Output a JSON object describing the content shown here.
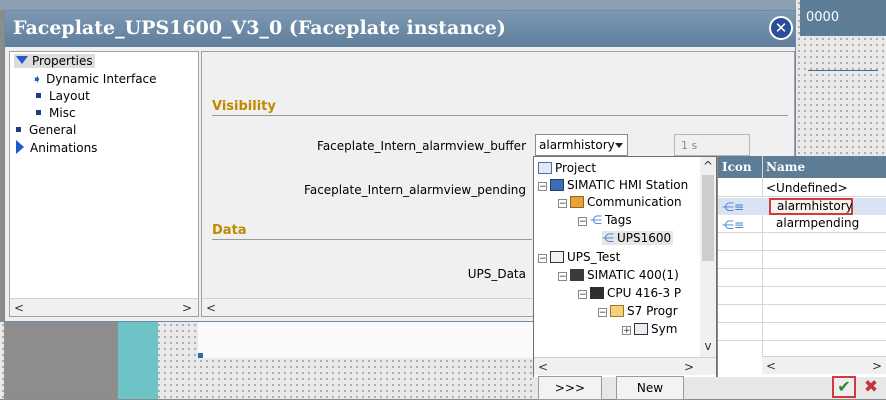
{
  "background": {
    "right_header_text": "0000"
  },
  "dialog": {
    "title": "Faceplate_UPS1600_V3_0 (Faceplate instance)",
    "close_symbol": "✕",
    "left_tree": [
      {
        "label": "Properties",
        "marker": "triangle-down",
        "selected": true
      },
      {
        "label": "Dynamic Interface",
        "marker": "arrow"
      },
      {
        "label": "Layout",
        "marker": "square"
      },
      {
        "label": "Misc",
        "marker": "square"
      },
      {
        "label": "General",
        "marker": "square"
      },
      {
        "label": "Animations",
        "marker": "triangle-right"
      }
    ],
    "sections": {
      "visibility": "Visibility",
      "data": "Data"
    },
    "props": {
      "buffer_label": "Faceplate_Intern_alarmview_buffer",
      "buffer_value": "alarmhistory",
      "buffer_time": "1 s",
      "pending_label": "Faceplate_Intern_alarmview_pending",
      "ups_data_label": "UPS_Data"
    }
  },
  "tag_picker": {
    "tree": [
      {
        "label": "Project",
        "level": 0
      },
      {
        "label": "SIMATIC HMI Station",
        "level": 1
      },
      {
        "label": "Communication",
        "level": 2
      },
      {
        "label": "Tags",
        "level": 3
      },
      {
        "label": "UPS1600",
        "level": 4
      },
      {
        "label": "UPS_Test",
        "level": 0
      },
      {
        "label": "SIMATIC 400(1)",
        "level": 1
      },
      {
        "label": "CPU 416-3 P",
        "level": 2
      },
      {
        "label": "S7 Progr",
        "level": 3
      },
      {
        "label": "Sym",
        "level": 4
      }
    ],
    "table": {
      "col_icon": "Icon",
      "col_name": "Name",
      "rows": [
        "<Undefined>",
        "alarmhistory",
        "alarmpending"
      ]
    },
    "buttons": {
      "more": ">>>",
      "new": "New",
      "ok": "✔",
      "cancel": "✖"
    }
  },
  "colors": {
    "titlebar": "#6f8ca8",
    "section_text": "#c08a00",
    "table_header": "#5d7d97",
    "accent_blue": "#1e5bc6"
  }
}
